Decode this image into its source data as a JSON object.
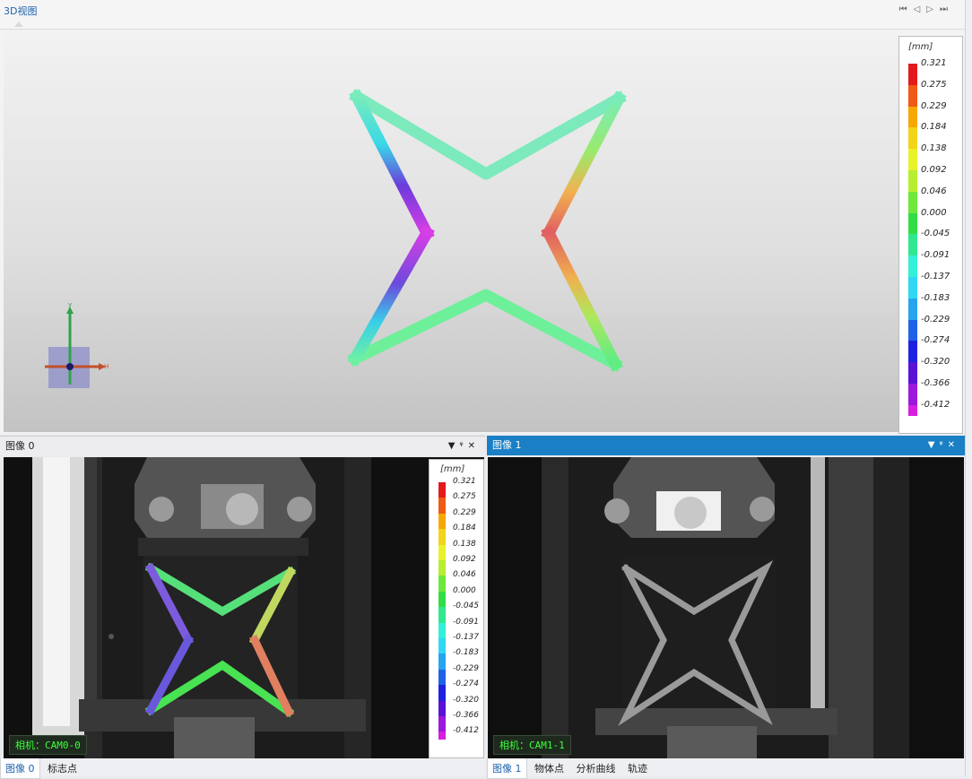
{
  "view3d": {
    "tab_title": "3D视图",
    "nav": [
      "⏮",
      "◁",
      "▷",
      "⏭"
    ],
    "axis": {
      "y": "y",
      "x": "H"
    }
  },
  "legend": {
    "unit": "[mm]",
    "ticks": [
      "0.321",
      "0.275",
      "0.229",
      "0.184",
      "0.138",
      "0.092",
      "0.046",
      "0.000",
      "-0.045",
      "-0.091",
      "-0.137",
      "-0.183",
      "-0.229",
      "-0.274",
      "-0.320",
      "-0.366",
      "-0.412"
    ],
    "colors": [
      "#e31a1c",
      "#f05a14",
      "#f7a800",
      "#f2d41a",
      "#e8f22a",
      "#b7ee30",
      "#6ee83a",
      "#33dd44",
      "#30e890",
      "#33f0d8",
      "#30d8f4",
      "#26a4f0",
      "#1e62e8",
      "#1e22e0",
      "#5a12d6",
      "#9c18dc",
      "#d81ee0"
    ]
  },
  "panel0": {
    "title": "图像 0",
    "icons": [
      "▼",
      "ᵠ",
      "✕"
    ],
    "camera": "相机：CAM0-0",
    "tabs": [
      "图像 0",
      "标志点"
    ]
  },
  "panel1": {
    "title": "图像 1",
    "icons": [
      "▼",
      "ᵠ",
      "✕"
    ],
    "camera": "相机：CAM1-1",
    "tabs": [
      "图像 1",
      "物体点",
      "分析曲线",
      "轨迹"
    ]
  }
}
